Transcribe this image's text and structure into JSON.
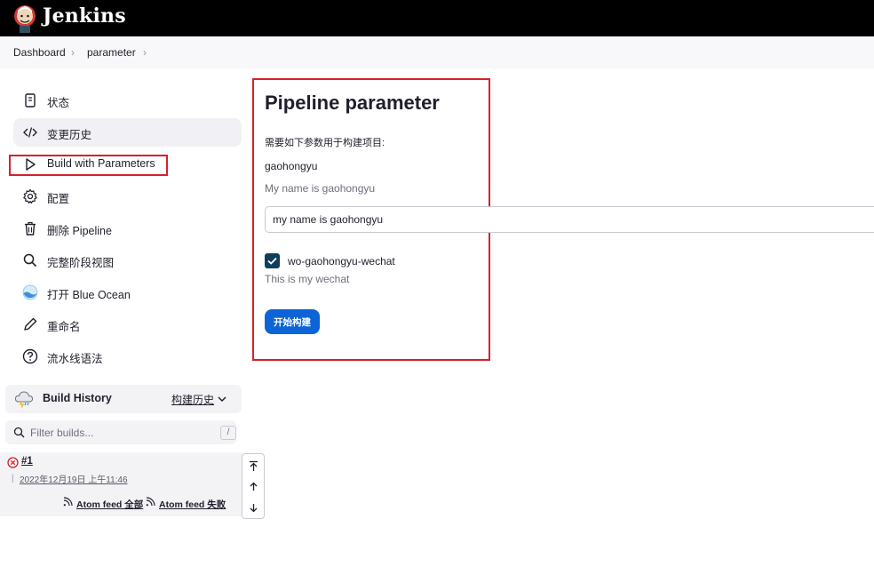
{
  "header": {
    "brand": "Jenkins"
  },
  "breadcrumb": [
    {
      "label": "Dashboard"
    },
    {
      "label": "parameter"
    }
  ],
  "sidebar": {
    "items": [
      {
        "label": "状态",
        "icon": "document-icon"
      },
      {
        "label": "变更历史",
        "icon": "code-icon"
      },
      {
        "label": "Build with Parameters",
        "icon": "play-icon"
      },
      {
        "label": "配置",
        "icon": "gear-icon"
      },
      {
        "label": "删除 Pipeline",
        "icon": "trash-icon"
      },
      {
        "label": "完整阶段视图",
        "icon": "search-icon"
      },
      {
        "label": "打开 Blue Ocean",
        "icon": "blue-ocean-icon"
      },
      {
        "label": "重命名",
        "icon": "pencil-icon"
      },
      {
        "label": "流水线语法",
        "icon": "help-icon"
      }
    ]
  },
  "build_history": {
    "title": "Build History",
    "link": "构建历史",
    "filter_placeholder": "Filter builds...",
    "filter_shortcut": "/",
    "builds": [
      {
        "number": "#1",
        "date": "2022年12月19日 上午11:46",
        "status": "failed"
      }
    ],
    "feed_all": "Atom feed 全部",
    "feed_failed": "Atom feed 失败"
  },
  "main": {
    "title": "Pipeline parameter",
    "description": "需要如下参数用于构建项目:",
    "string_param": {
      "name": "gaohongyu",
      "description": "My name is gaohongyu",
      "value": "my name is gaohongyu"
    },
    "bool_param": {
      "name": "wo-gaohongyu-wechat",
      "description": "This is my wechat",
      "checked": true
    },
    "build_button": "开始构建"
  },
  "colors": {
    "header_bg": "#000000",
    "accent_blue": "#0c64d6",
    "highlight_red": "#d6202c",
    "checkbox": "#0f3f5c"
  }
}
